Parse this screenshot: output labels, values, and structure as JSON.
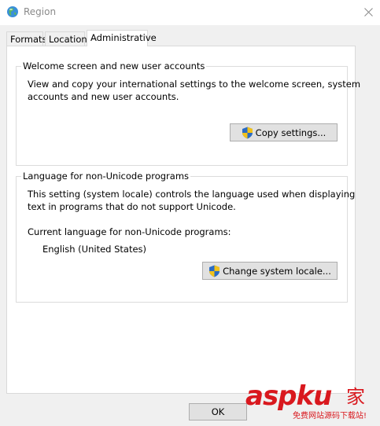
{
  "window": {
    "title": "Region"
  },
  "tabs": [
    {
      "label": "Formats",
      "active": false
    },
    {
      "label": "Location",
      "active": false
    },
    {
      "label": "Administrative",
      "active": true
    }
  ],
  "welcome_group": {
    "title": "Welcome screen and new user accounts",
    "description_line1": "View and copy your international settings to the welcome screen, system",
    "description_line2": "accounts and new user accounts.",
    "copy_button_label": "Copy settings..."
  },
  "unicode_group": {
    "title": "Language for non-Unicode programs",
    "description_line1": "This setting (system locale) controls the language used when displaying",
    "description_line2": "text in programs that do not support Unicode.",
    "current_label": "Current language for non-Unicode programs:",
    "current_value": "English (United States)",
    "change_button_label": "Change system locale..."
  },
  "footer": {
    "ok_label": "OK",
    "watermark_main": "aspku",
    "watermark_char": "家",
    "watermark_sub": "免费网站源码下载站!"
  },
  "colors": {
    "shield_blue": "#2b6cc4",
    "shield_yellow": "#f2c21b",
    "watermark_red": "#d9181e"
  }
}
